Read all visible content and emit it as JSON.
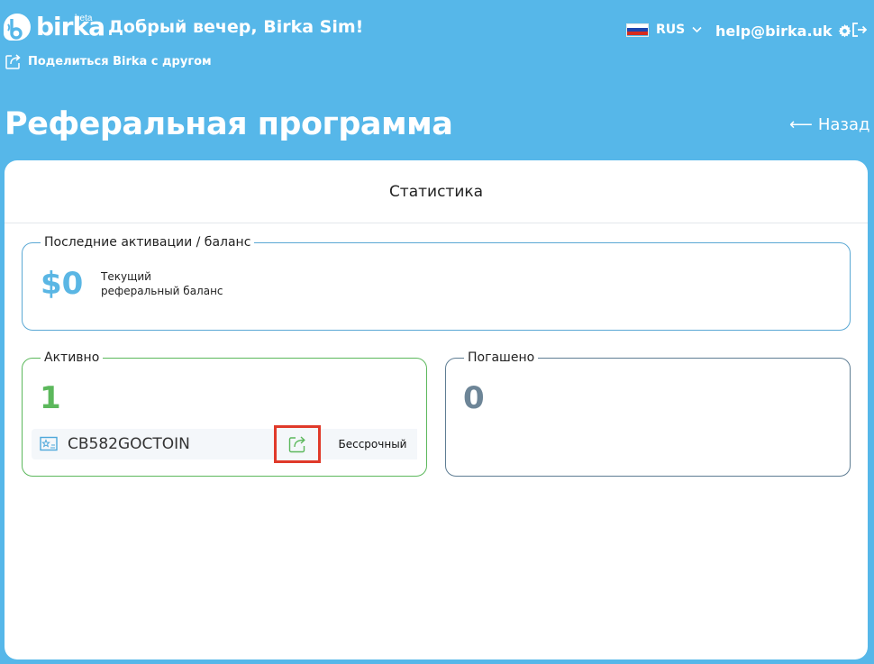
{
  "header": {
    "logo_text": "birka",
    "logo_beta": "beta",
    "greeting": "Добрый вечер, Birka Sim!",
    "language": "RUS",
    "email": "help@birka.uk",
    "share_link": "Поделиться Birka с другом"
  },
  "page": {
    "title": "Реферальная программа",
    "back_label": "Назад",
    "back_arrow": "⟵"
  },
  "card": {
    "title": "Статистика",
    "balance": {
      "legend": "Последние активации / баланс",
      "amount": "$0",
      "label_line1": "Текущий",
      "label_line2": "реферальный баланс"
    },
    "active": {
      "legend": "Активно",
      "count": "1",
      "codes": [
        {
          "code": "CB582GOCTOIN",
          "term": "Бессрочный"
        }
      ]
    },
    "used": {
      "legend": "Погашено",
      "count": "0"
    }
  },
  "colors": {
    "background": "#56b7e9",
    "accent_blue": "#5ab6e4",
    "active_green": "#5cb85c",
    "used_gray": "#6d8597",
    "highlight_red": "#e03a2a"
  },
  "icons": [
    "logo-mark-icon",
    "russia-flag-icon",
    "chevron-down-icon",
    "gear-icon",
    "logout-icon",
    "share-icon",
    "ticket-icon",
    "share-code-icon"
  ]
}
